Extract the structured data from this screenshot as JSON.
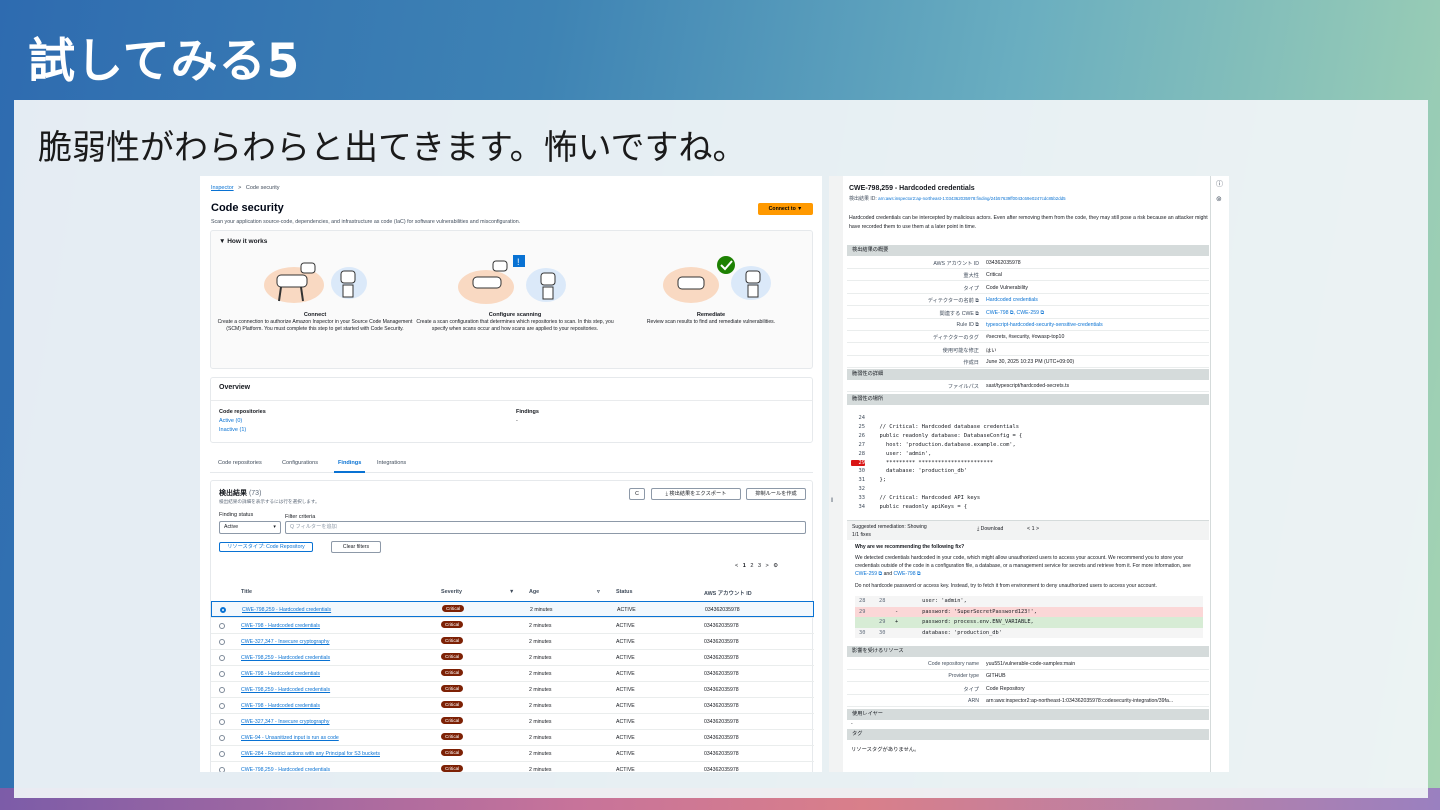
{
  "slide": {
    "title": "試してみる5",
    "subtitle": "脆弱性がわらわらと出てきます。怖いですね。"
  },
  "left": {
    "breadcrumb": {
      "root": "Inspector",
      "sep": ">",
      "current": "Code security"
    },
    "title": "Code security",
    "description": "Scan your application source-code, dependencies, and infrastructure as code (IaC) for software vulnerabilities and misconfiguration.",
    "connect_button": "Connect to ▼",
    "how_it_works": {
      "header": "▼  How it works",
      "steps": [
        {
          "title": "Connect",
          "text": "Create a connection to authorize Amazon Inspector in your Source Code Management (SCM) Platform. You must complete this step to get started with Code Security."
        },
        {
          "title": "Configure scanning",
          "text": "Create a scan configuration that determines which repositories to scan. In this step, you specify when scans occur and how scans are applied to your repositories."
        },
        {
          "title": "Remediate",
          "text": "Review scan results to find and remediate vulnerabilities."
        }
      ]
    },
    "overview": {
      "header": "Overview",
      "repos_label": "Code repositories",
      "active": "Active (0)",
      "inactive": "Inactive (1)",
      "findings_label": "Findings",
      "findings_value": "-"
    },
    "tabs": [
      "Code repositories",
      "Configurations",
      "Findings",
      "Integrations"
    ],
    "findings": {
      "title": "検出結果",
      "count": "(73)",
      "desc": "検出結果の詳細を表示するには行を選択します。",
      "refresh": "C",
      "export": "⤓  検出結果をエクスポート",
      "suppress": "抑制ルールを作成",
      "status_label": "Finding status",
      "status_value": "Active",
      "filter_label": "Filter criteria",
      "filter_placeholder": "Q  フィルターを追加",
      "chip": "リソースタイプ: Code Repository",
      "clear": "Clear filters",
      "pager": {
        "prev": "<",
        "p1": "1",
        "p2": "2",
        "p3": "3",
        "next": ">",
        "gear": "⚙"
      },
      "columns": [
        "Title",
        "Severity",
        "Age",
        "Status",
        "AWS アカウント ID"
      ],
      "rows": [
        {
          "title": "CWE-798,259 - Hardcoded credentials",
          "severity": "Critical",
          "age": "2 minutes",
          "status": "ACTIVE",
          "account": "034362035978"
        },
        {
          "title": "CWE-798 - Hardcoded credentials",
          "severity": "Critical",
          "age": "2 minutes",
          "status": "ACTIVE",
          "account": "034362035978"
        },
        {
          "title": "CWE-327,347 - Insecure cryptography",
          "severity": "Critical",
          "age": "2 minutes",
          "status": "ACTIVE",
          "account": "034362035978"
        },
        {
          "title": "CWE-798,259 - Hardcoded credentials",
          "severity": "Critical",
          "age": "2 minutes",
          "status": "ACTIVE",
          "account": "034362035978"
        },
        {
          "title": "CWE-798 - Hardcoded credentials",
          "severity": "Critical",
          "age": "2 minutes",
          "status": "ACTIVE",
          "account": "034362035978"
        },
        {
          "title": "CWE-798,259 - Hardcoded credentials",
          "severity": "Critical",
          "age": "2 minutes",
          "status": "ACTIVE",
          "account": "034362035978"
        },
        {
          "title": "CWE-798 - Hardcoded credentials",
          "severity": "Critical",
          "age": "2 minutes",
          "status": "ACTIVE",
          "account": "034362035978"
        },
        {
          "title": "CWE-327,347 - Insecure cryptography",
          "severity": "Critical",
          "age": "2 minutes",
          "status": "ACTIVE",
          "account": "034362035978"
        },
        {
          "title": "CWE-94 - Unsanitized input is run as code",
          "severity": "Critical",
          "age": "2 minutes",
          "status": "ACTIVE",
          "account": "034362035978"
        },
        {
          "title": "CWE-284 - Restrict actions with any Principal for S3 buckets",
          "severity": "Critical",
          "age": "2 minutes",
          "status": "ACTIVE",
          "account": "034362035978"
        },
        {
          "title": "CWE-798,259 - Hardcoded credentials",
          "severity": "Critical",
          "age": "2 minutes",
          "status": "ACTIVE",
          "account": "034362035978"
        }
      ]
    }
  },
  "right": {
    "title": "CWE-798,259 - Hardcoded credentials",
    "id_label": "検出結果 ID:",
    "id_value": "arn:aws:inspector2:ap-northeast-1:034362035978:finding/24b57639ff0043c69e0247cdc85b2dd5",
    "description": "Hardcoded credentials can be intercepted by malicious actors. Even after removing them from the code, they may still pose a risk because an attacker might have recorded them to use them at a later point in time.",
    "summary_header": "検出結果の概要",
    "summary": [
      {
        "k": "AWS アカウント ID",
        "v": "034362035978"
      },
      {
        "k": "重大性",
        "v": "Critical"
      },
      {
        "k": "タイプ",
        "v": "Code Vulnerability"
      },
      {
        "k": "ディテクターの名前 ⧉",
        "v": "Hardcoded credentials",
        "link": true
      },
      {
        "k": "関連する CWE ⧉",
        "v": "CWE-798 ⧉, CWE-259 ⧉",
        "link": true
      },
      {
        "k": "Rule ID ⧉",
        "v": "typescript-hardcoded-security-sensitive-credentials",
        "link": true
      },
      {
        "k": "ディテクターのタグ",
        "v": "#secrets, #security, #owasp-top10"
      },
      {
        "k": "使用可能な修正",
        "v": "はい"
      },
      {
        "k": "作成日",
        "v": "June 30, 2025 10:23 PM (UTC+09:00)"
      }
    ],
    "vuln_header": "脆弱性の詳細",
    "filepath_label": "ファイルパス",
    "filepath_value": "sast/typescript/hardcoded-secrets.ts",
    "location_header": "脆弱性の場所",
    "code": [
      {
        "n": "24",
        "t": ""
      },
      {
        "n": "25",
        "t": "  // Critical: Hardcoded database credentials"
      },
      {
        "n": "26",
        "t": "  public readonly database: DatabaseConfig = {"
      },
      {
        "n": "27",
        "t": "    host: 'production.database.example.com',"
      },
      {
        "n": "28",
        "t": "    user: 'admin',"
      },
      {
        "n": "29",
        "t": "    ********* ***********************"
      },
      {
        "n": "30",
        "t": "    database: 'production_db'"
      },
      {
        "n": "31",
        "t": "  };"
      },
      {
        "n": "32",
        "t": ""
      },
      {
        "n": "33",
        "t": "  // Critical: Hardcoded API keys"
      },
      {
        "n": "34",
        "t": "  public readonly apiKeys = {"
      }
    ],
    "remediation": {
      "label": "Suggested remediation: Showing 1/1 fixes",
      "download": "⤓  Download",
      "pager": "<    1    >",
      "why": "Why are we recommending the following fix?",
      "text1": "We detected credentials hardcoded in your code, which might allow unauthorized users to access your account. We recommend you to store your credentials outside of the code in a configuration file, a database, or a management service for secrets and retrieve from it. For more information, see",
      "link1": "CWE-259 ⧉",
      "and": "and",
      "link2": "CWE-798 ⧉",
      "text2": "Do not hardcode password or access key. Instead, try to fetch it from environment to deny unauthorized users to access your account.",
      "diff": [
        {
          "a": "28",
          "b": "28",
          "s": "",
          "t": "      user: 'admin',",
          "kind": "ctx"
        },
        {
          "a": "29",
          "b": "",
          "s": "-",
          "t": "      password: 'SuperSecretPassword123!',",
          "kind": "del"
        },
        {
          "a": "",
          "b": "29",
          "s": "+",
          "t": "      password: process.env.ENV_VARIABLE,",
          "kind": "add"
        },
        {
          "a": "30",
          "b": "30",
          "s": "",
          "t": "      database: 'production_db'",
          "kind": "ctx"
        }
      ]
    },
    "resources_header": "影響を受けるリソース",
    "resources": [
      {
        "k": "Code repository name",
        "v": "yuu551/vulnerable-code-samples:main"
      },
      {
        "k": "Provider type",
        "v": "GITHUB"
      },
      {
        "k": "タイプ",
        "v": "Code Repository"
      },
      {
        "k": "ARN",
        "v": "arn:aws:inspector2:ap-northeast-1:034362035978:codesecurity-integration/39fa..."
      }
    ],
    "layer_header": "使用レイヤー",
    "layer_value": "-",
    "tags_header": "タグ",
    "tags_value": "リソースタグがありません。"
  },
  "colors": {
    "accent": "#0972d3",
    "critical": "#7d2105",
    "button": "#ff9900"
  }
}
